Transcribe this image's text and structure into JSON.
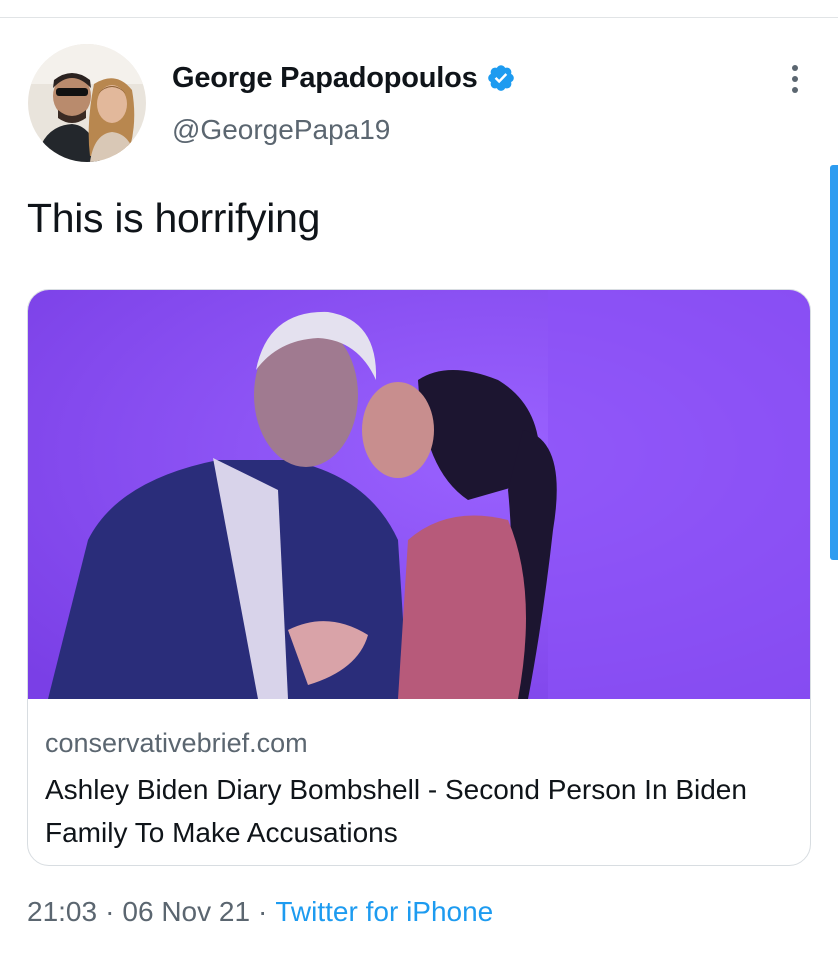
{
  "tweet": {
    "author": {
      "display_name": "George Papadopoulos",
      "handle": "@GeorgePapa19",
      "verified": true
    },
    "text": "This is horrifying",
    "link_card": {
      "image_description_icon": "photo",
      "domain": "conservativebrief.com",
      "title": "Ashley Biden Diary Bombshell - Second Person In Biden Family To Make Accusations"
    },
    "meta": {
      "time": "21:03",
      "date": "06 Nov 21",
      "separator": "·",
      "source": "Twitter for iPhone"
    }
  },
  "colors": {
    "verified_blue": "#1d9bf0",
    "link_blue": "#1d9bf0",
    "secondary_text": "#5b6670",
    "card_photo_background": "#8a4ff0",
    "scroll_indicator": "#2d9cf0"
  },
  "icons": {
    "verified": "verified-badge-icon",
    "more": "more-vertical-icon"
  }
}
